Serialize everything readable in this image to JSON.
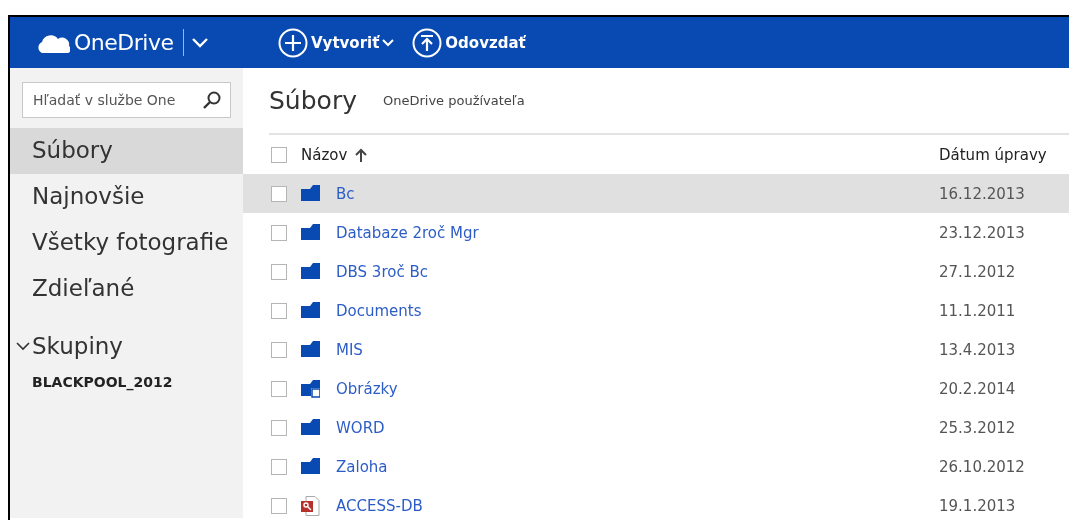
{
  "header": {
    "brand": "OneDrive",
    "actions": [
      {
        "kind": "create",
        "label": "Vytvoriť",
        "dropdown": true
      },
      {
        "kind": "upload",
        "label": "Odovzdať",
        "dropdown": false
      }
    ]
  },
  "sidebar": {
    "search": {
      "placeholder": "Hľadať v službe One"
    },
    "items": [
      {
        "label": "Súbory",
        "selected": true
      },
      {
        "label": "Najnovšie",
        "selected": false
      },
      {
        "label": "Všetky fotografie",
        "selected": false
      },
      {
        "label": "Zdieľané",
        "selected": false
      }
    ],
    "groups": {
      "label": "Skupiny",
      "expanded": true,
      "children": [
        {
          "label": "BLACKPOOL_2012"
        }
      ]
    }
  },
  "content": {
    "title": "Súbory",
    "subtitle": "OneDrive používateľa",
    "select_all": {
      "checked": false
    },
    "columns": [
      {
        "label": "Názov",
        "sort_ascending": true
      },
      {
        "label": "Dátum úpravy"
      }
    ],
    "rows": [
      {
        "kind": "folder",
        "name": "Bc",
        "date": "16.12.2013",
        "selected": true,
        "checked": false
      },
      {
        "kind": "folder",
        "name": "Databaze 2roč Mgr",
        "date": "23.12.2013",
        "selected": false,
        "checked": false
      },
      {
        "kind": "folder",
        "name": "DBS 3roč Bc",
        "date": "27.1.2012",
        "selected": false,
        "checked": false
      },
      {
        "kind": "folder",
        "name": "Documents",
        "date": "11.1.2011",
        "selected": false,
        "checked": false
      },
      {
        "kind": "folder",
        "name": "MIS",
        "date": "13.4.2013",
        "selected": false,
        "checked": false
      },
      {
        "kind": "photos",
        "name": "Obrázky",
        "date": "20.2.2014",
        "selected": false,
        "checked": false
      },
      {
        "kind": "folder",
        "name": "WORD",
        "date": "25.3.2012",
        "selected": false,
        "checked": false
      },
      {
        "kind": "folder",
        "name": "Zaloha",
        "date": "26.10.2012",
        "selected": false,
        "checked": false
      },
      {
        "kind": "access",
        "name": "ACCESS-DB",
        "date": "19.1.2013",
        "selected": false,
        "checked": false
      }
    ]
  }
}
